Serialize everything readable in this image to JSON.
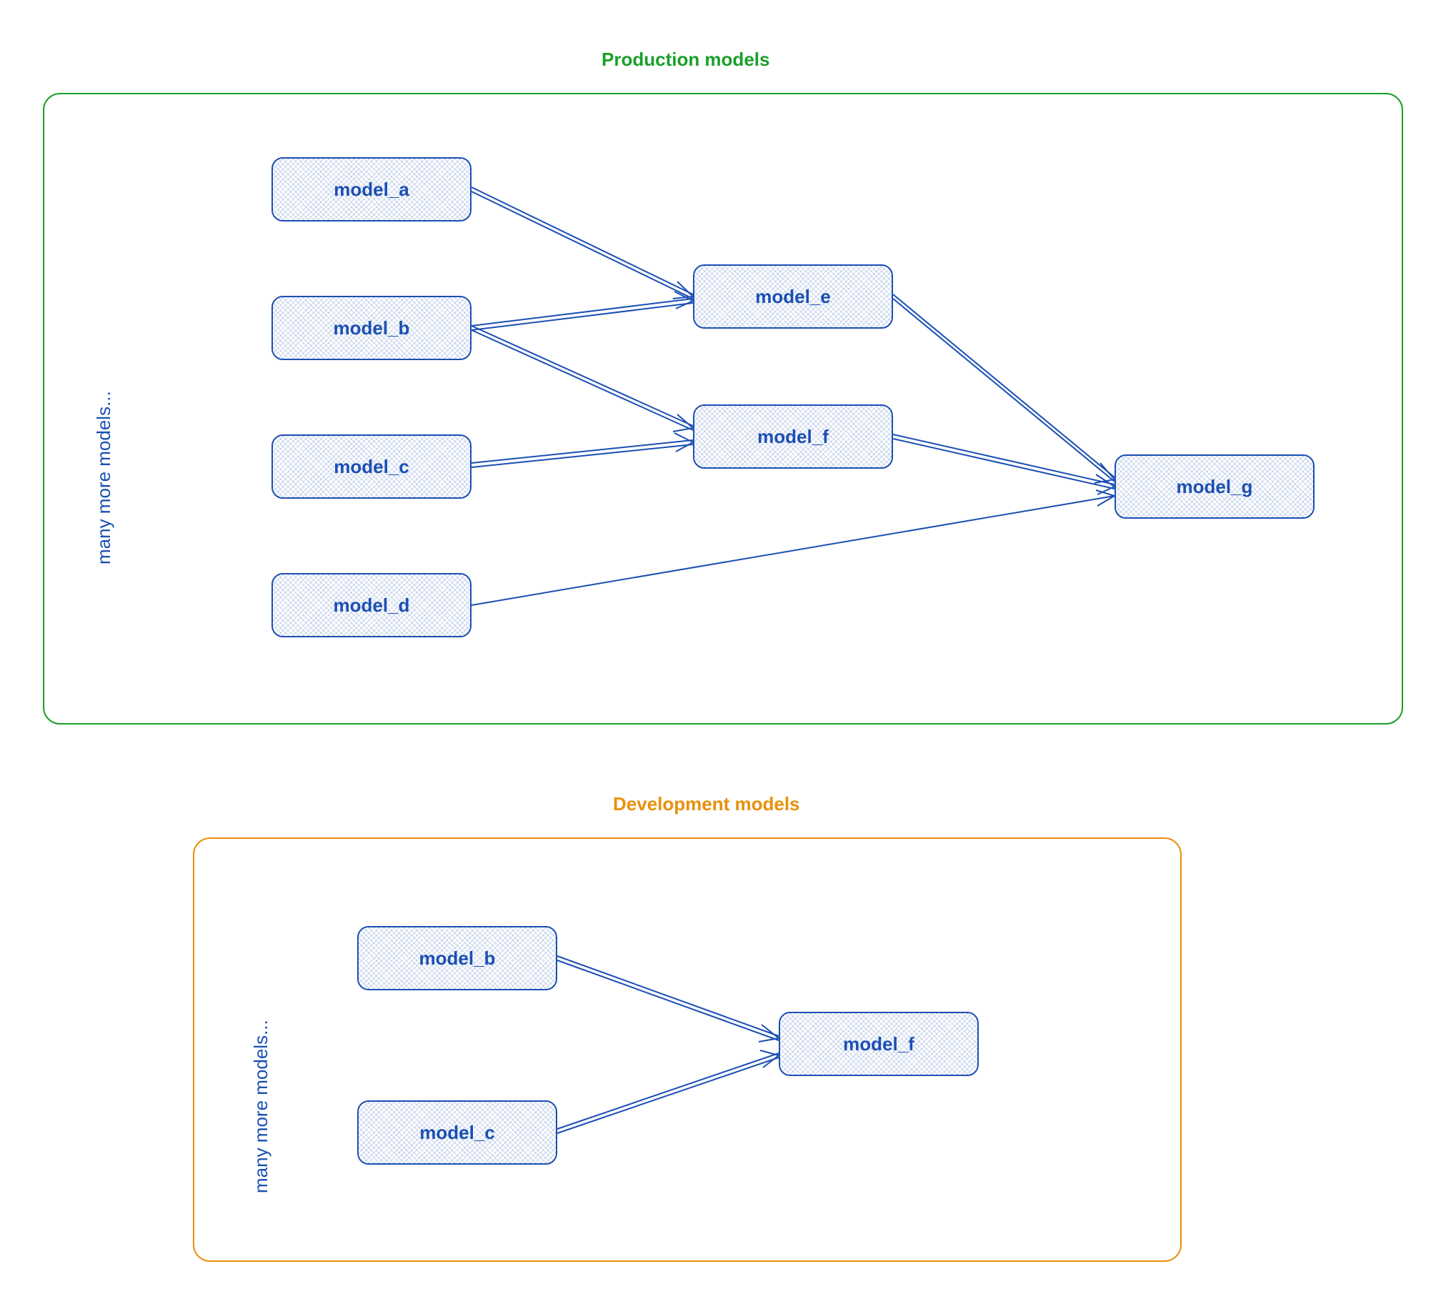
{
  "colors": {
    "node_stroke": "#1b4fb3",
    "node_text": "#1b4fb3",
    "production_border": "#1a9f29",
    "development_border": "#e8900c"
  },
  "production": {
    "title": "Production models",
    "side_note": "many more models...",
    "nodes": {
      "model_a": "model_a",
      "model_b": "model_b",
      "model_c": "model_c",
      "model_d": "model_d",
      "model_e": "model_e",
      "model_f": "model_f",
      "model_g": "model_g"
    },
    "edges": [
      [
        "model_a",
        "model_e"
      ],
      [
        "model_b",
        "model_e"
      ],
      [
        "model_b",
        "model_f"
      ],
      [
        "model_c",
        "model_f"
      ],
      [
        "model_e",
        "model_g"
      ],
      [
        "model_f",
        "model_g"
      ],
      [
        "model_d",
        "model_g"
      ]
    ]
  },
  "development": {
    "title": "Development models",
    "side_note": "many more models...",
    "nodes": {
      "model_b": "model_b",
      "model_c": "model_c",
      "model_f": "model_f"
    },
    "edges": [
      [
        "model_b",
        "model_f"
      ],
      [
        "model_c",
        "model_f"
      ]
    ]
  }
}
